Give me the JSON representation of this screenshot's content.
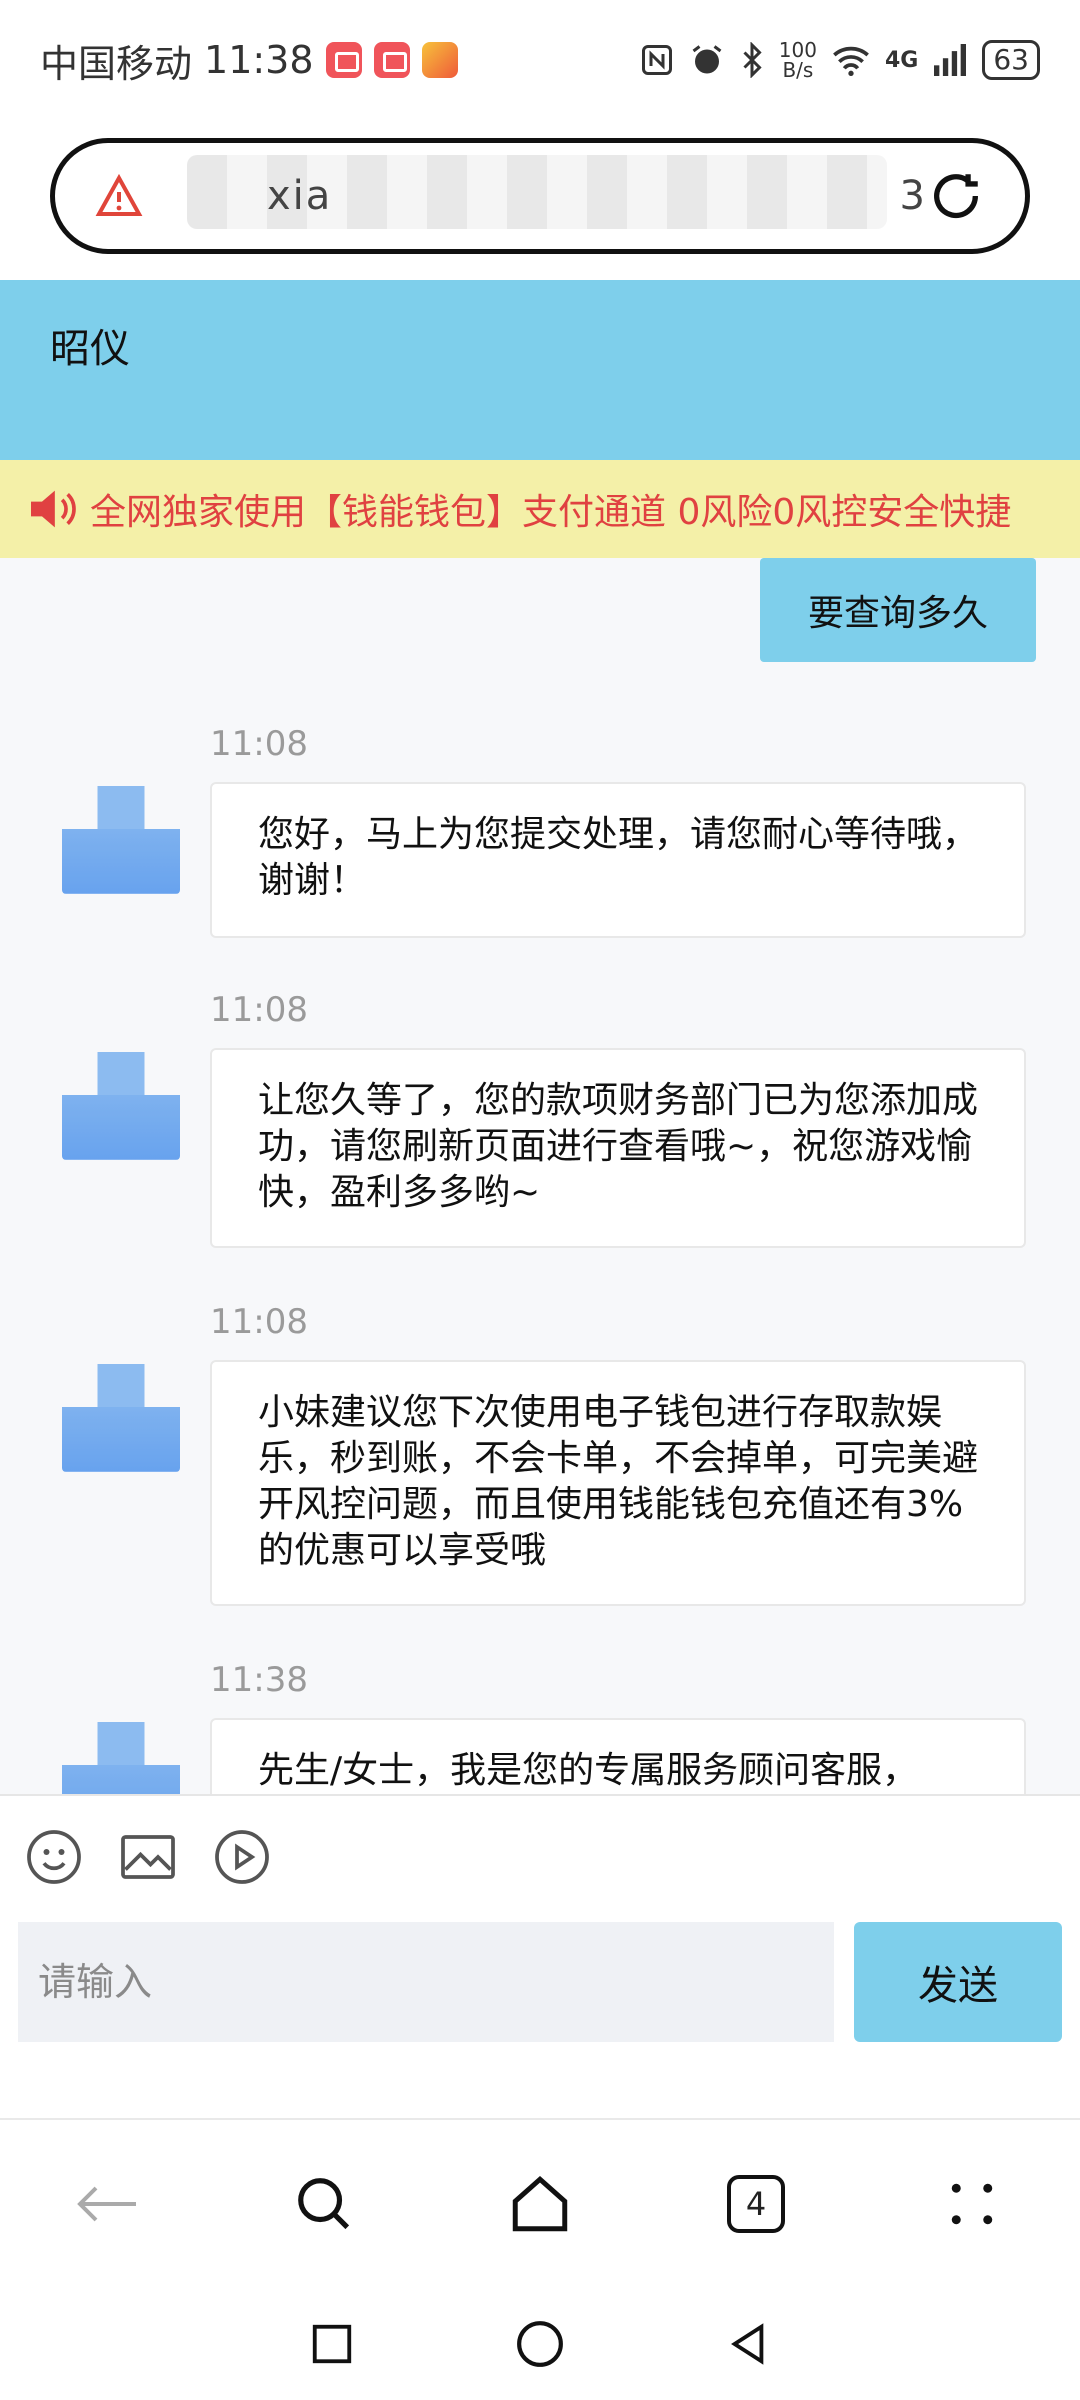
{
  "status_bar": {
    "carrier": "中国移动",
    "time": "11:38",
    "net_speed_value": "100",
    "net_speed_unit": "B/s",
    "network": "4G",
    "battery": "63"
  },
  "url_bar": {
    "visible_fragment_start": "xia",
    "visible_fragment_end": "3"
  },
  "header": {
    "title": "昭仪"
  },
  "notice": {
    "text": "全网独家使用【钱能钱包】支付通道 0风险0风控安全快捷"
  },
  "chat": {
    "outgoing": [
      {
        "text": "要查询多久"
      }
    ],
    "incoming": [
      {
        "time": "11:08",
        "text": "您好，马上为您提交处理，请您耐心等待哦，谢谢！"
      },
      {
        "time": "11:08",
        "text": "让您久等了，您的款项财务部门已为您添加成功，请您刷新页面进行查看哦~，祝您游戏愉快，盈利多多哟~"
      },
      {
        "time": "11:08",
        "text": "小妹建议您下次使用电子钱包进行存取款娱乐，秒到账，不会卡单，不会掉单，可完美避开风控问题，而且使用钱能钱包充值还有3%的优惠可以享受哦"
      },
      {
        "time": "11:38",
        "text": "先生/女士，我是您的专属服务顾问客服，"
      }
    ]
  },
  "composer": {
    "placeholder": "请输入",
    "send_label": "发送"
  },
  "browser_nav": {
    "tab_count": "4"
  },
  "colors": {
    "accent": "#7ecfeb",
    "notice_bg": "#f4f0a8",
    "notice_text": "#e04141"
  }
}
